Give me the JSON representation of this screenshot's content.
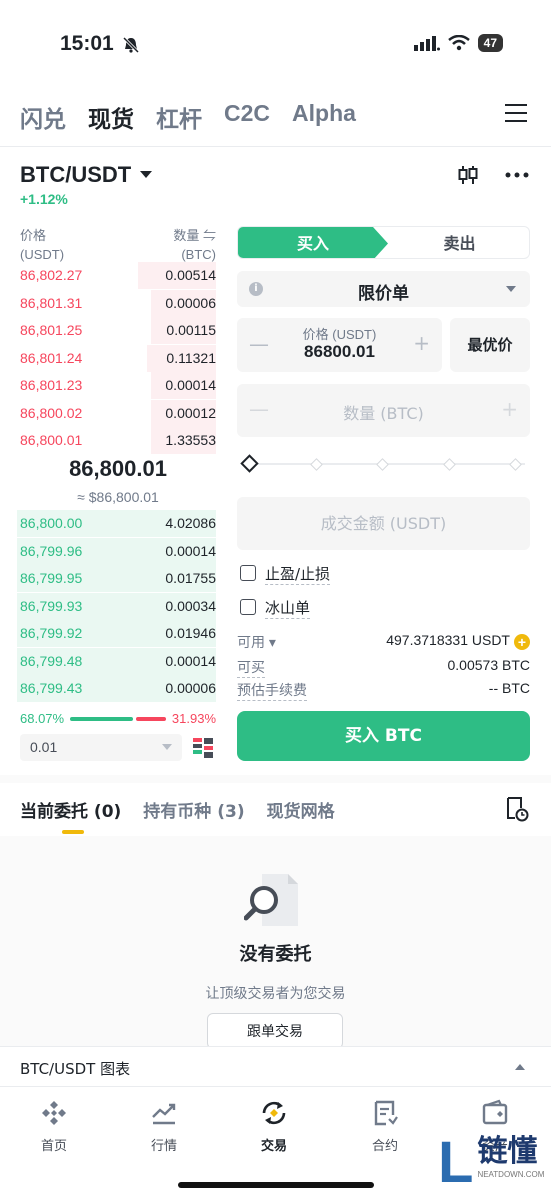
{
  "status": {
    "time": "15:01",
    "battery": "47"
  },
  "top_tabs": [
    "闪兑",
    "现货",
    "杠杆",
    "C2C",
    "Alpha"
  ],
  "pair": {
    "symbol": "BTC/USDT",
    "change": "+1.12%"
  },
  "orderbook": {
    "price_header": "价格",
    "price_unit": "(USDT)",
    "qty_header": "数量 ⇋",
    "qty_unit": "(BTC)",
    "asks": [
      {
        "price": "86,802.27",
        "qty": "0.00514",
        "depth": 0.36
      },
      {
        "price": "86,801.31",
        "qty": "0.00006",
        "depth": 0.3
      },
      {
        "price": "86,801.25",
        "qty": "0.00115",
        "depth": 0.3
      },
      {
        "price": "86,801.24",
        "qty": "0.11321",
        "depth": 0.32
      },
      {
        "price": "86,801.23",
        "qty": "0.00014",
        "depth": 0.3
      },
      {
        "price": "86,800.02",
        "qty": "0.00012",
        "depth": 0.3
      },
      {
        "price": "86,800.01",
        "qty": "1.33553",
        "depth": 0.3
      }
    ],
    "mid_price": "86,800.01",
    "mid_sub": "≈ $86,800.01",
    "bids": [
      {
        "price": "86,800.00",
        "qty": "4.02086",
        "depth": 0.92
      },
      {
        "price": "86,799.96",
        "qty": "0.00014",
        "depth": 0.92
      },
      {
        "price": "86,799.95",
        "qty": "0.01755",
        "depth": 0.92
      },
      {
        "price": "86,799.93",
        "qty": "0.00034",
        "depth": 0.92
      },
      {
        "price": "86,799.92",
        "qty": "0.01946",
        "depth": 0.92
      },
      {
        "price": "86,799.48",
        "qty": "0.00014",
        "depth": 0.92
      },
      {
        "price": "86,799.43",
        "qty": "0.00006",
        "depth": 0.92
      }
    ],
    "buy_ratio": "68.07%",
    "sell_ratio": "31.93%",
    "depth_value": "0.01"
  },
  "form": {
    "buy_tab": "买入",
    "sell_tab": "卖出",
    "order_type": "限价单",
    "price_label": "价格 (USDT)",
    "price_value": "86800.01",
    "best_price": "最优价",
    "qty_placeholder": "数量 (BTC)",
    "total_placeholder": "成交金额 (USDT)",
    "tp_sl": "止盈/止损",
    "iceberg": "冰山单",
    "available_label": "可用 ▾",
    "available_value": "497.3718331 USDT",
    "max_buy_label": "可买",
    "max_buy_value": "0.00573 BTC",
    "fee_label": "预估手续费",
    "fee_value": "-- BTC",
    "buy_button": "买入 BTC"
  },
  "orders": {
    "tabs": [
      "当前委托 (0)",
      "持有币种 (3)",
      "现货网格"
    ],
    "empty_title": "没有委托",
    "empty_sub": "让顶级交易者为您交易",
    "copy_trade": "跟单交易"
  },
  "chart_bar": "BTC/USDT 图表",
  "nav": [
    "首页",
    "行情",
    "交易",
    "合约",
    "资产"
  ],
  "watermark": {
    "char": "L",
    "text": "链懂",
    "sub": "NEATDOWN.COM"
  },
  "colors": {
    "green": "#2ebd85",
    "red": "#f6465d",
    "yellow": "#f0b90b"
  }
}
